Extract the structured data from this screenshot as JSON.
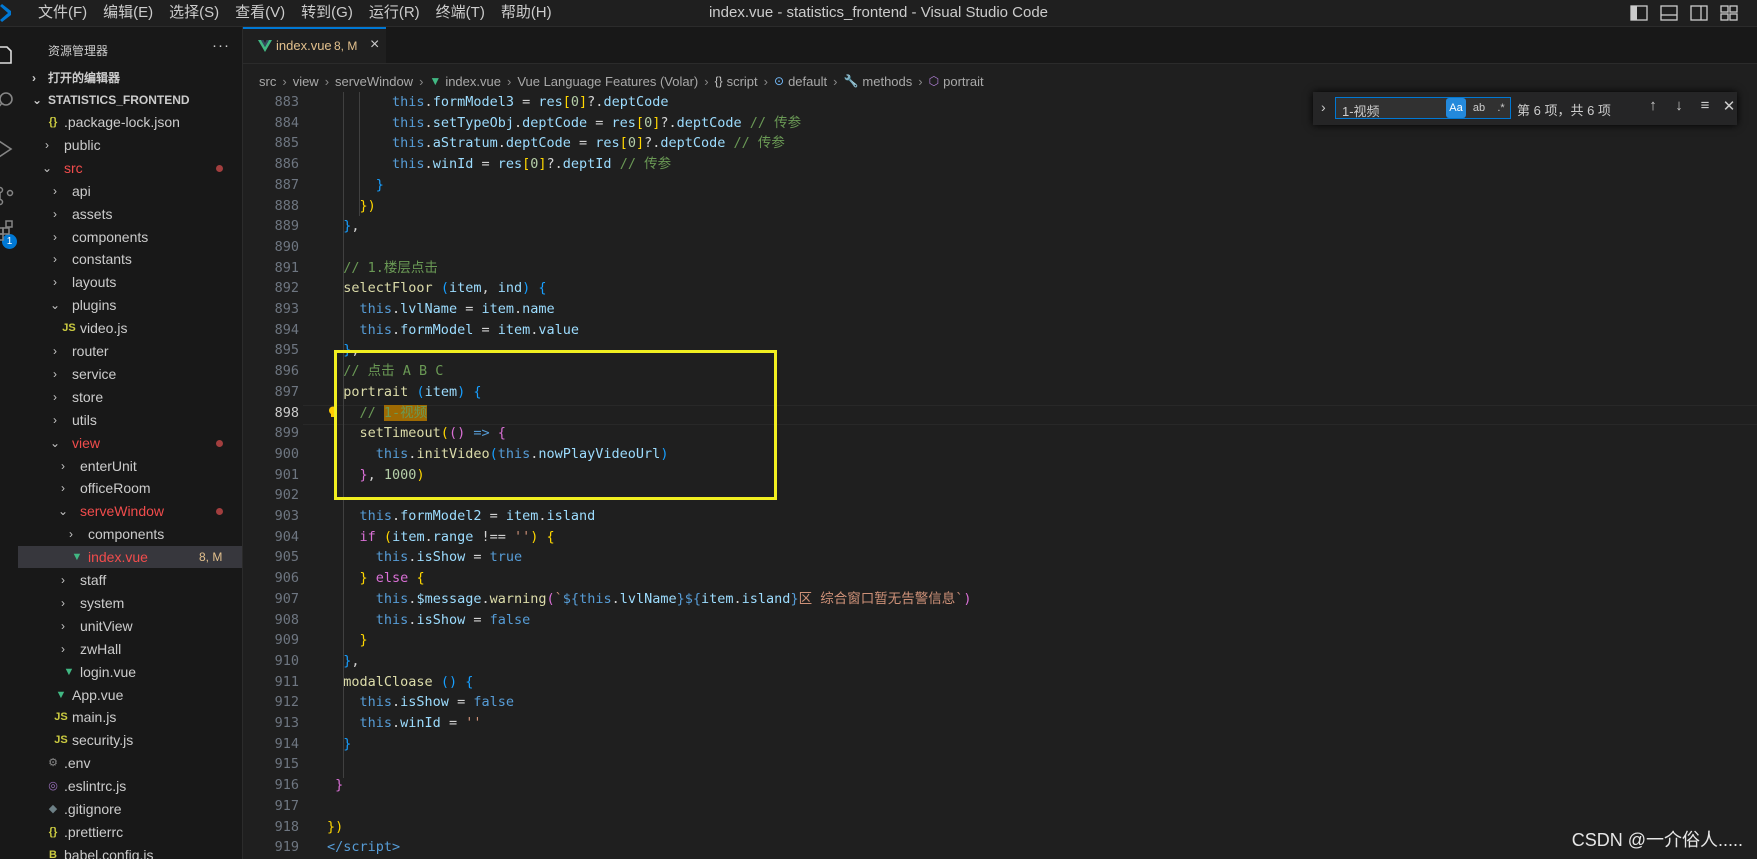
{
  "menu": [
    "文件(F)",
    "编辑(E)",
    "选择(S)",
    "查看(V)",
    "转到(G)",
    "运行(R)",
    "终端(T)",
    "帮助(H)"
  ],
  "window_title": "index.vue - statistics_frontend - Visual Studio Code",
  "activity_badge": "1",
  "sidebar": {
    "title": "资源管理器",
    "more": "···",
    "open_editors": "打开的编辑器",
    "project": "STATISTICS_FRONTEND"
  },
  "tree": [
    {
      "label": ".package-lock.json",
      "type": "file",
      "depth": 1,
      "icon": "{}"
    },
    {
      "label": "public",
      "type": "folder",
      "depth": 1,
      "open": false
    },
    {
      "label": "src",
      "type": "folder",
      "depth": 1,
      "open": true,
      "status": "red",
      "dot": true
    },
    {
      "label": "api",
      "type": "folder",
      "depth": 2,
      "open": false
    },
    {
      "label": "assets",
      "type": "folder",
      "depth": 2,
      "open": false
    },
    {
      "label": "components",
      "type": "folder",
      "depth": 2,
      "open": false
    },
    {
      "label": "constants",
      "type": "folder",
      "depth": 2,
      "open": false
    },
    {
      "label": "layouts",
      "type": "folder",
      "depth": 2,
      "open": false
    },
    {
      "label": "plugins",
      "type": "folder",
      "depth": 2,
      "open": true
    },
    {
      "label": "video.js",
      "type": "file",
      "depth": 3,
      "icon": "JS"
    },
    {
      "label": "router",
      "type": "folder",
      "depth": 2,
      "open": false
    },
    {
      "label": "service",
      "type": "folder",
      "depth": 2,
      "open": false
    },
    {
      "label": "store",
      "type": "folder",
      "depth": 2,
      "open": false
    },
    {
      "label": "utils",
      "type": "folder",
      "depth": 2,
      "open": false
    },
    {
      "label": "view",
      "type": "folder",
      "depth": 2,
      "open": true,
      "status": "red",
      "dot": true
    },
    {
      "label": "enterUnit",
      "type": "folder",
      "depth": 3,
      "open": false
    },
    {
      "label": "officeRoom",
      "type": "folder",
      "depth": 3,
      "open": false
    },
    {
      "label": "serveWindow",
      "type": "folder",
      "depth": 3,
      "open": true,
      "status": "red",
      "dot": true
    },
    {
      "label": "components",
      "type": "folder",
      "depth": 4,
      "open": false
    },
    {
      "label": "index.vue",
      "type": "file",
      "depth": 4,
      "icon": "vue",
      "status": "red",
      "dec": "8, M",
      "selected": true
    },
    {
      "label": "staff",
      "type": "folder",
      "depth": 3,
      "open": false
    },
    {
      "label": "system",
      "type": "folder",
      "depth": 3,
      "open": false
    },
    {
      "label": "unitView",
      "type": "folder",
      "depth": 3,
      "open": false
    },
    {
      "label": "zwHall",
      "type": "folder",
      "depth": 3,
      "open": false
    },
    {
      "label": "login.vue",
      "type": "file",
      "depth": 3,
      "icon": "vue"
    },
    {
      "label": "App.vue",
      "type": "file",
      "depth": 2,
      "icon": "vue"
    },
    {
      "label": "main.js",
      "type": "file",
      "depth": 2,
      "icon": "JS"
    },
    {
      "label": "security.js",
      "type": "file",
      "depth": 2,
      "icon": "JS"
    },
    {
      "label": ".env",
      "type": "file",
      "depth": 1,
      "icon": "gear"
    },
    {
      "label": ".eslintrc.js",
      "type": "file",
      "depth": 1,
      "icon": "eslint"
    },
    {
      "label": ".gitignore",
      "type": "file",
      "depth": 1,
      "icon": "git"
    },
    {
      "label": ".prettierrc",
      "type": "file",
      "depth": 1,
      "icon": "{}"
    },
    {
      "label": "babel.config.js",
      "type": "file",
      "depth": 1,
      "icon": "babel"
    }
  ],
  "tab": {
    "label": "index.vue",
    "decoration": "8, M",
    "close": "×"
  },
  "breadcrumb": [
    "src",
    "view",
    "serveWindow",
    "index.vue",
    "Vue Language Features (Volar)",
    "script",
    "default",
    "methods",
    "portrait"
  ],
  "find": {
    "query": "1-视频",
    "case": "Aa",
    "word": "ab",
    "regex": ".*",
    "count": "第 6 项，共 6 项"
  },
  "editor": {
    "current_line": 898,
    "lines": [
      {
        "n": 883,
        "html": "        <span class=\"k\">this</span>.<span class=\"v\">formModel3</span> = <span class=\"v\">res</span><span class=\"p1\">[</span><span class=\"n\">0</span><span class=\"p1\">]</span>?.<span class=\"v\">deptCode</span>"
      },
      {
        "n": 884,
        "html": "        <span class=\"k\">this</span>.<span class=\"v\">setTypeObj</span>.<span class=\"v\">deptCode</span> = <span class=\"v\">res</span><span class=\"p1\">[</span><span class=\"n\">0</span><span class=\"p1\">]</span>?.<span class=\"v\">deptCode</span> <span class=\"c\">// 传参</span>"
      },
      {
        "n": 885,
        "html": "        <span class=\"k\">this</span>.<span class=\"v\">aStratum</span>.<span class=\"v\">deptCode</span> = <span class=\"v\">res</span><span class=\"p1\">[</span><span class=\"n\">0</span><span class=\"p1\">]</span>?.<span class=\"v\">deptCode</span> <span class=\"c\">// 传参</span>"
      },
      {
        "n": 886,
        "html": "        <span class=\"k\">this</span>.<span class=\"v\">winId</span> = <span class=\"v\">res</span><span class=\"p1\">[</span><span class=\"n\">0</span><span class=\"p1\">]</span>?.<span class=\"v\">deptId</span> <span class=\"c\">// 传参</span>"
      },
      {
        "n": 887,
        "html": "      <span class=\"p3\">}</span>"
      },
      {
        "n": 888,
        "html": "    <span class=\"p1\">})</span>"
      },
      {
        "n": 889,
        "html": "  <span class=\"p3\">}</span>,"
      },
      {
        "n": 890,
        "html": ""
      },
      {
        "n": 891,
        "html": "  <span class=\"c\">// 1.楼层点击</span>"
      },
      {
        "n": 892,
        "html": "  <span class=\"f\">selectFloor</span> <span class=\"p3\">(</span><span class=\"v\">item</span>, <span class=\"v\">ind</span><span class=\"p3\">)</span> <span class=\"p3\">{</span>"
      },
      {
        "n": 893,
        "html": "    <span class=\"k\">this</span>.<span class=\"v\">lvlName</span> = <span class=\"v\">item</span>.<span class=\"v\">name</span>"
      },
      {
        "n": 894,
        "html": "    <span class=\"k\">this</span>.<span class=\"v\">formModel</span> = <span class=\"v\">item</span>.<span class=\"v\">value</span>"
      },
      {
        "n": 895,
        "html": "  <span class=\"p3\">}</span>,"
      },
      {
        "n": 896,
        "html": "  <span class=\"c\">// 点击 A B C</span>"
      },
      {
        "n": 897,
        "html": "  <span class=\"f\">portrait</span> <span class=\"p3\">(</span><span class=\"v\">item</span><span class=\"p3\">)</span> <span class=\"p3\">{</span>"
      },
      {
        "n": 898,
        "html": "    <span class=\"c\">// </span><span class=\"hl\">1-视频</span>"
      },
      {
        "n": 899,
        "html": "    <span class=\"f\">setTimeout</span><span class=\"p1\">(</span><span class=\"p2\">()</span> <span class=\"k\">=&gt;</span> <span class=\"p2\">{</span>"
      },
      {
        "n": 900,
        "html": "      <span class=\"k\">this</span>.<span class=\"f\">initVideo</span><span class=\"p3\">(</span><span class=\"k\">this</span>.<span class=\"v\">nowPlayVideoUrl</span><span class=\"p3\">)</span>"
      },
      {
        "n": 901,
        "html": "    <span class=\"p2\">}</span>, <span class=\"n\">1000</span><span class=\"p1\">)</span>"
      },
      {
        "n": 902,
        "html": ""
      },
      {
        "n": 903,
        "html": "    <span class=\"k\">this</span>.<span class=\"v\">formModel2</span> = <span class=\"v\">item</span>.<span class=\"v\">island</span>"
      },
      {
        "n": 904,
        "html": "    <span class=\"p2\">if</span> <span class=\"p1\">(</span><span class=\"v\">item</span>.<span class=\"v\">range</span> !== <span class=\"s\">''</span><span class=\"p1\">)</span> <span class=\"p1\">{</span>"
      },
      {
        "n": 905,
        "html": "      <span class=\"k\">this</span>.<span class=\"v\">isShow</span> = <span class=\"k\">true</span>"
      },
      {
        "n": 906,
        "html": "    <span class=\"p1\">}</span> <span class=\"p2\">else</span> <span class=\"p1\">{</span>"
      },
      {
        "n": 907,
        "html": "      <span class=\"k\">this</span>.<span class=\"v\">$message</span>.<span class=\"f\">warning</span><span class=\"p2\">(</span><span class=\"s\">`</span><span class=\"k\">${</span><span class=\"k\">this</span>.<span class=\"v\">lvlName</span><span class=\"k\">}${</span><span class=\"v\">item</span>.<span class=\"v\">island</span><span class=\"k\">}</span><span class=\"s\">区 综合窗口暂无告警信息`</span><span class=\"p2\">)</span>"
      },
      {
        "n": 908,
        "html": "      <span class=\"k\">this</span>.<span class=\"v\">isShow</span> = <span class=\"k\">false</span>"
      },
      {
        "n": 909,
        "html": "    <span class=\"p1\">}</span>"
      },
      {
        "n": 910,
        "html": "  <span class=\"p3\">}</span>,"
      },
      {
        "n": 911,
        "html": "  <span class=\"f\">modalCloase</span> <span class=\"p3\">()</span> <span class=\"p3\">{</span>"
      },
      {
        "n": 912,
        "html": "    <span class=\"k\">this</span>.<span class=\"v\">isShow</span> = <span class=\"k\">false</span>"
      },
      {
        "n": 913,
        "html": "    <span class=\"k\">this</span>.<span class=\"v\">winId</span> = <span class=\"s\">''</span>"
      },
      {
        "n": 914,
        "html": "  <span class=\"p3\">}</span>"
      },
      {
        "n": 915,
        "html": ""
      },
      {
        "n": 916,
        "html": " <span class=\"p2\">}</span>"
      },
      {
        "n": 917,
        "html": ""
      },
      {
        "n": 918,
        "html": "<span class=\"p1\">}</span><span class=\"p1\">)</span>"
      },
      {
        "n": 919,
        "html": "<span class=\"k\">&lt;/</span><span class=\"k\">script</span><span class=\"k\">&gt;</span>"
      }
    ]
  },
  "watermark": "CSDN @一介俗人....."
}
